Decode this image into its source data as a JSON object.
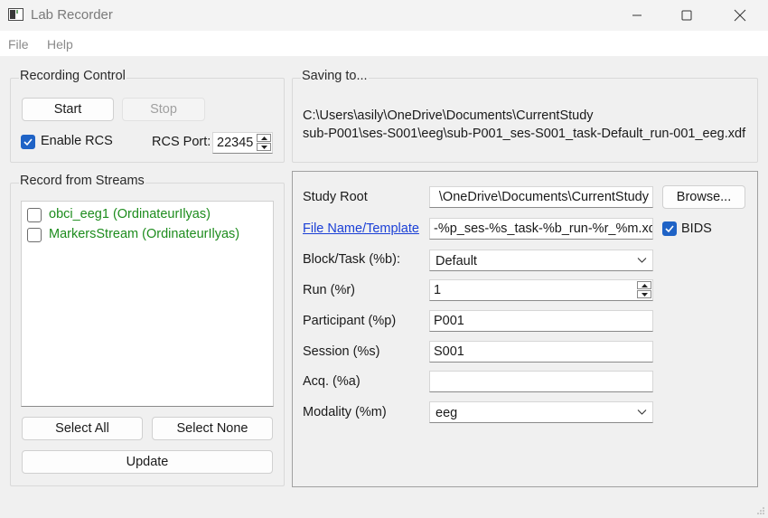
{
  "window": {
    "title": "Lab Recorder",
    "icon": "window-app-icon",
    "controls": [
      "minimize-icon",
      "maximize-icon",
      "close-icon"
    ]
  },
  "menu": {
    "items": [
      {
        "label": "File"
      },
      {
        "label": "Help"
      }
    ]
  },
  "recording_control": {
    "title": "Recording Control",
    "start_label": "Start",
    "stop_label": "Stop",
    "enable_rcs_label": "Enable RCS",
    "enable_rcs_checked": true,
    "rcs_port_label": "RCS Port:",
    "rcs_port_value": "22345"
  },
  "saving": {
    "title": "Saving to...",
    "line1": "C:\\Users\\asily\\OneDrive\\Documents\\CurrentStudy",
    "line2": "sub-P001\\ses-S001\\eeg\\sub-P001_ses-S001_task-Default_run-001_eeg.xdf"
  },
  "streams": {
    "title": "Record from Streams",
    "items": [
      {
        "label": "obci_eeg1 (OrdinateurIlyas)",
        "checked": false
      },
      {
        "label": "MarkersStream (OrdinateurIlyas)",
        "checked": false
      }
    ],
    "select_all_label": "Select All",
    "select_none_label": "Select None",
    "update_label": "Update"
  },
  "settings": {
    "study_root_label": "Study Root",
    "study_root_value": "\\OneDrive\\Documents\\CurrentStudy",
    "browse_label": "Browse...",
    "file_name_label": "File Name/Template",
    "file_name_value": "-%p_ses-%s_task-%b_run-%r_%m.xdf",
    "bids_label": "BIDS",
    "bids_checked": true,
    "block_task_label": "Block/Task (%b):",
    "block_task_value": "Default",
    "run_label": "Run (%r)",
    "run_value": "1",
    "participant_label": "Participant (%p)",
    "participant_value": "P001",
    "session_label": "Session (%s)",
    "session_value": "S001",
    "acq_label": "Acq. (%a)",
    "acq_value": "",
    "modality_label": "Modality (%m)",
    "modality_value": "eeg"
  },
  "colors": {
    "accent": "#1f63c6",
    "stream_text": "#1d8c1d",
    "link": "#1a3fd6"
  }
}
